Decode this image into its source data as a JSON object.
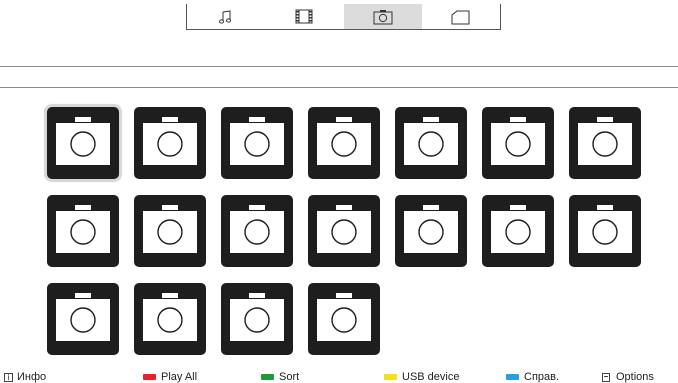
{
  "tabs": [
    {
      "icon": "music-note-icon",
      "active": false
    },
    {
      "icon": "film-icon",
      "active": false
    },
    {
      "icon": "camera-icon",
      "active": true
    },
    {
      "icon": "folder-icon",
      "active": false
    }
  ],
  "grid": {
    "item_icon": "camera-icon",
    "count": 18,
    "selected_index": 0
  },
  "legend": {
    "info": {
      "icon": "info-icon",
      "label": "Инфо"
    },
    "red": {
      "color": "#e8202a",
      "label": "Play All"
    },
    "green": {
      "color": "#1f9a3a",
      "label": "Sort"
    },
    "yellow": {
      "color": "#f1e01e",
      "label": "USB device"
    },
    "blue": {
      "color": "#1ea3e0",
      "label": "Справ."
    },
    "options": {
      "icon": "options-icon",
      "label": "Options"
    }
  }
}
